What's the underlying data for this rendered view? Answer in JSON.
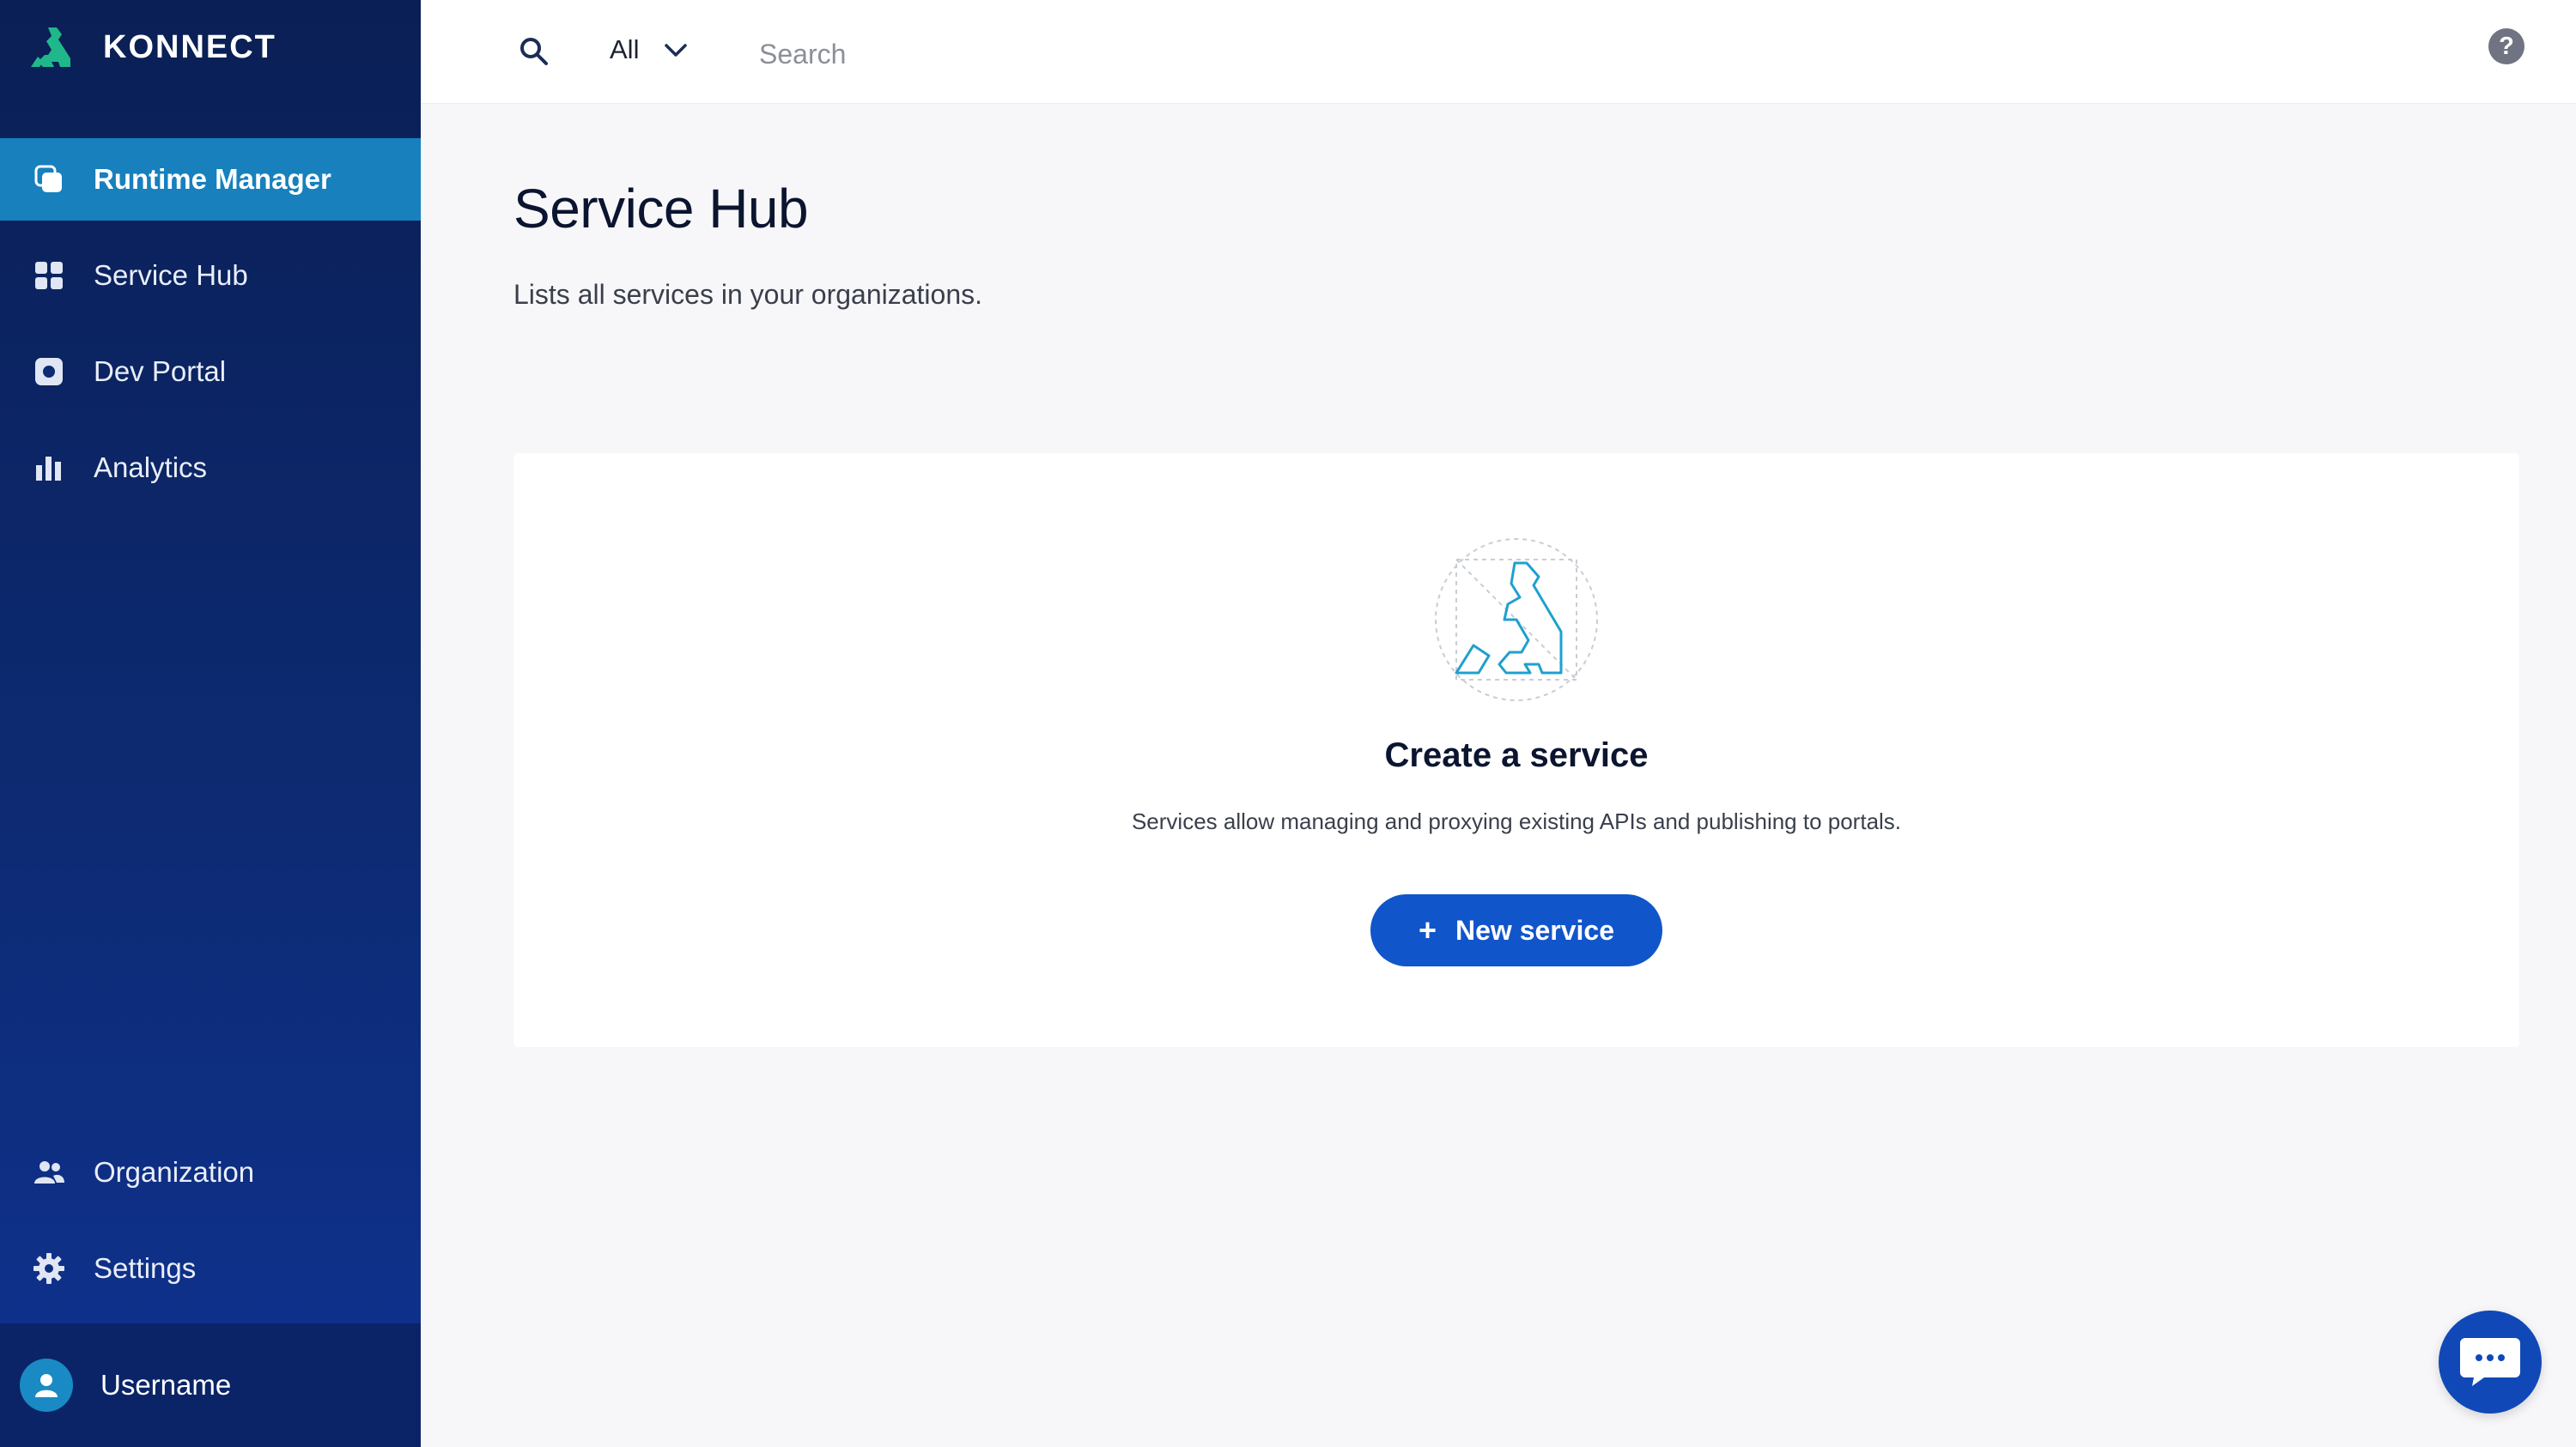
{
  "brand": {
    "name": "KONNECT"
  },
  "sidebar": {
    "items": [
      {
        "label": "Runtime Manager",
        "icon": "runtime-manager-icon",
        "active": true
      },
      {
        "label": "Service Hub",
        "icon": "service-hub-icon",
        "active": false
      },
      {
        "label": "Dev Portal",
        "icon": "dev-portal-icon",
        "active": false
      },
      {
        "label": "Analytics",
        "icon": "analytics-icon",
        "active": false
      }
    ],
    "bottom_items": [
      {
        "label": "Organization",
        "icon": "organization-icon"
      },
      {
        "label": "Settings",
        "icon": "gear-icon"
      }
    ],
    "user": {
      "name": "Username"
    },
    "colors": {
      "background": "#0b2467",
      "active": "#1780bd"
    }
  },
  "topbar": {
    "filter_label": "All",
    "search_placeholder": "Search",
    "help_label": "?"
  },
  "main": {
    "title": "Service Hub",
    "subtitle": "Lists all services in your organizations.",
    "empty_state": {
      "title": "Create a service",
      "description": "Services allow managing and proxying existing APIs and publishing to portals.",
      "button_label": "New service",
      "button_icon": "plus-icon"
    }
  },
  "colors": {
    "primary_button": "#1155cb",
    "brand_accent": "#1fb88a",
    "illustration": "#1fa0cf"
  }
}
